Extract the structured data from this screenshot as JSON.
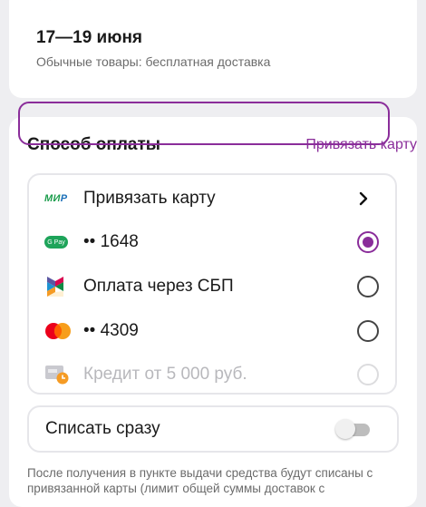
{
  "delivery": {
    "date": "17—19 июня",
    "note": "Обычные товары: бесплатная доставка"
  },
  "payment": {
    "title": "Способ оплаты",
    "link_card": "Привязать карту",
    "methods": [
      {
        "label": "Привязать карту",
        "icon": "mir-card-icon"
      },
      {
        "label": "•• 1648",
        "icon": "google-pay-icon",
        "selected": true
      },
      {
        "label": "Оплата через СБП",
        "icon": "sbp-icon"
      },
      {
        "label": "•• 4309",
        "icon": "mastercard-icon"
      },
      {
        "label": "Кредит от 5 000 руб.",
        "icon": "credit-icon",
        "disabled": true
      }
    ],
    "icon_text": {
      "mir": "МИР",
      "gpay": "G Pay"
    },
    "instant_label": "Списать сразу",
    "footer": "После получения в пункте выдачи средства будут списаны с привязанной карты (лимит общей суммы доставок с"
  },
  "colors": {
    "accent": "#8a2d9a",
    "background": "#eeeef1"
  }
}
